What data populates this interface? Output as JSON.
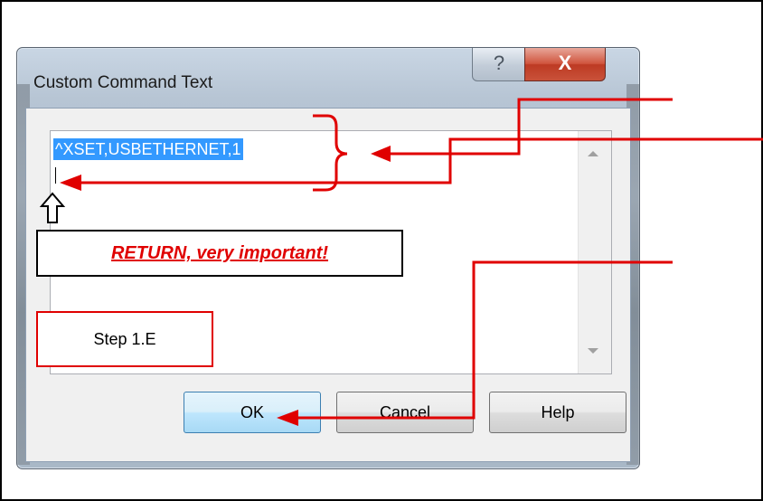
{
  "dialog": {
    "title": "Custom Command Text",
    "help_glyph": "?",
    "close_glyph": "X",
    "text_value": "^XSET,USBETHERNET,1",
    "buttons": {
      "ok": "OK",
      "cancel": "Cancel",
      "help": "Help"
    }
  },
  "annotations": {
    "callout": "RETURN, very important!",
    "step": "Step 1.E",
    "accent_color": "#e00000"
  }
}
